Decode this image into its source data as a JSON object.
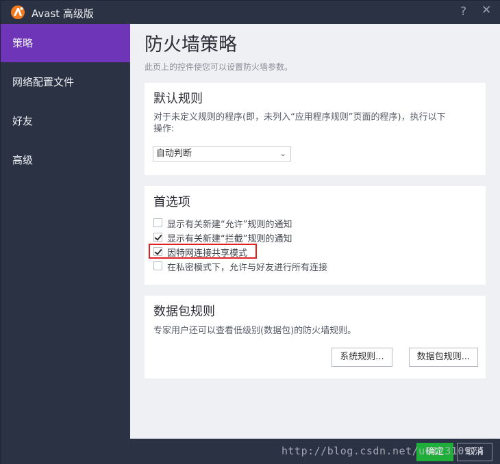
{
  "window": {
    "title": "Avast 高级版"
  },
  "titlebar": {
    "help": "?",
    "close": "✕"
  },
  "sidebar": {
    "items": [
      {
        "label": "策略",
        "active": true
      },
      {
        "label": "网络配置文件",
        "active": false
      },
      {
        "label": "好友",
        "active": false
      },
      {
        "label": "高级",
        "active": false
      }
    ]
  },
  "main": {
    "title": "防火墙策略",
    "subtitle": "此页上的控件使您可以设置防火墙参数。",
    "default_rules": {
      "title": "默认规则",
      "description_line1": "对于未定义规则的程序(即，未列入“应用程序规则”页面的程序)，执行以下",
      "description_line2": "操作:",
      "select_value": "自动判断"
    },
    "preferences": {
      "title": "首选项",
      "options": [
        {
          "label": "显示有关新建“允许”规则的通知",
          "checked": false
        },
        {
          "label": "显示有关新建“拦截”规则的通知",
          "checked": true
        },
        {
          "label": "因特网连接共享模式",
          "checked": true
        },
        {
          "label": "在私密模式下，允许与好友进行所有连接",
          "checked": false
        }
      ]
    },
    "packet_rules": {
      "title": "数据包规则",
      "description": "专家用户还可以查看低级别(数据包)的防火墙规则。",
      "system_rules_button": "系统规则...",
      "packet_rules_button": "数据包规则..."
    }
  },
  "footer": {
    "ok_label": "确定",
    "cancel_label": "取消",
    "watermark": "http://blog.csdn.net/u012310974"
  },
  "colors": {
    "sidebar_bg": "#2b3244",
    "active_item": "#6f35b8",
    "ok_button": "#1fae3a",
    "highlight_border": "#e02020",
    "logo": "#f47a20"
  }
}
